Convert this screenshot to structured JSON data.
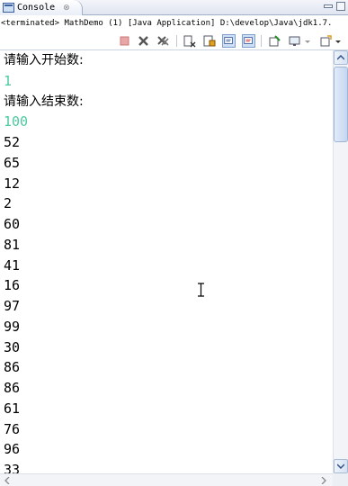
{
  "tab": {
    "label": "Console",
    "close_glyph": "⊗"
  },
  "status_text": "<terminated> MathDemo (1) [Java Application] D:\\develop\\Java\\jdk1.7.",
  "console_lines": [
    {
      "text": "请输入开始数:",
      "kind": "prompt"
    },
    {
      "text": "1",
      "kind": "input"
    },
    {
      "text": "请输入结束数:",
      "kind": "prompt"
    },
    {
      "text": "100",
      "kind": "input"
    },
    {
      "text": "52",
      "kind": "out"
    },
    {
      "text": "65",
      "kind": "out"
    },
    {
      "text": "12",
      "kind": "out"
    },
    {
      "text": "2",
      "kind": "out"
    },
    {
      "text": "60",
      "kind": "out"
    },
    {
      "text": "81",
      "kind": "out"
    },
    {
      "text": "41",
      "kind": "out"
    },
    {
      "text": "16",
      "kind": "out"
    },
    {
      "text": "97",
      "kind": "out"
    },
    {
      "text": "99",
      "kind": "out"
    },
    {
      "text": "30",
      "kind": "out"
    },
    {
      "text": "86",
      "kind": "out"
    },
    {
      "text": "86",
      "kind": "out"
    },
    {
      "text": "61",
      "kind": "out"
    },
    {
      "text": "76",
      "kind": "out"
    },
    {
      "text": "96",
      "kind": "out"
    },
    {
      "text": "33",
      "kind": "out"
    }
  ],
  "colors": {
    "input_text": "#4ec9a0",
    "output_text": "#000000"
  },
  "toolbar_icons": [
    "terminate-icon",
    "remove-launch-icon",
    "remove-all-terminated-icon",
    "clear-console-icon",
    "scroll-lock-icon",
    "show-on-stdout-icon",
    "show-on-stderr-icon",
    "pin-console-icon",
    "display-selected-console-icon",
    "open-console-icon"
  ]
}
